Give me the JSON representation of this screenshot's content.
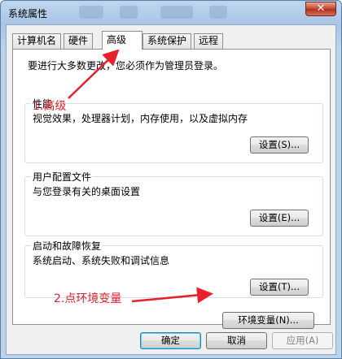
{
  "window": {
    "title": "系统属性",
    "close_glyph": "✕"
  },
  "tabs": [
    {
      "label": "计算机名",
      "active": false
    },
    {
      "label": "硬件",
      "active": false
    },
    {
      "label": "高级",
      "active": true
    },
    {
      "label": "系统保护",
      "active": false
    },
    {
      "label": "远程",
      "active": false
    }
  ],
  "panel": {
    "note": "要进行大多数更改，您必须作为管理员登录。",
    "groups": [
      {
        "title": "性能",
        "desc": "视觉效果，处理器计划，内存使用，以及虚拟内存",
        "button": "设置(S)..."
      },
      {
        "title": "用户配置文件",
        "desc": "与您登录有关的桌面设置",
        "button": "设置(E)..."
      },
      {
        "title": "启动和故障恢复",
        "desc": "系统启动、系统失败和调试信息",
        "button": "设置(T)..."
      }
    ],
    "env_button": "环境变量(N)..."
  },
  "footer": {
    "ok": "确定",
    "cancel": "取消",
    "apply": "应用(A)"
  },
  "annotations": {
    "step1": "1.高级",
    "step2": "2.点环境变量",
    "color": "#e8202a"
  }
}
